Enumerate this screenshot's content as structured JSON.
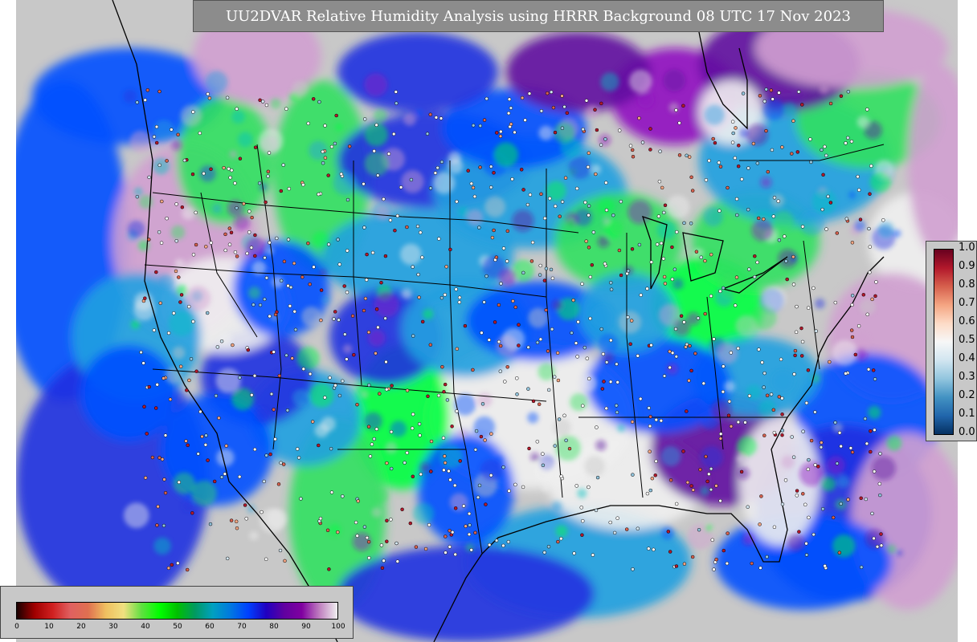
{
  "title": "UU2DVAR Relative Humidity Analysis using HRRR Background 08 UTC 17 Nov 2023",
  "colorbars": {
    "rh": {
      "ticks": [
        "0",
        "10",
        "20",
        "30",
        "40",
        "50",
        "60",
        "70",
        "80",
        "90",
        "100"
      ],
      "range": [
        0,
        100
      ],
      "stops": [
        "#1a0000",
        "#a00000",
        "#d02020",
        "#e06060",
        "#e07050",
        "#f0c060",
        "#f0e080",
        "#60e040",
        "#00ff00",
        "#00c000",
        "#009a60",
        "#00a0c0",
        "#0078e0",
        "#0040ff",
        "#2000c0",
        "#6000a0",
        "#8000a0",
        "#c080c0",
        "#f0f0f0"
      ]
    },
    "difference": {
      "ticks": [
        "0.0",
        "0.1",
        "0.2",
        "0.3",
        "0.4",
        "0.5",
        "0.6",
        "0.7",
        "0.8",
        "0.9",
        "1.0"
      ],
      "range": [
        0.0,
        1.0
      ],
      "stops": [
        "#053061",
        "#2166ac",
        "#4393c3",
        "#92c5de",
        "#d1e5f0",
        "#f7f7f7",
        "#fddbc7",
        "#f4a582",
        "#d6604d",
        "#b2182b",
        "#67001f"
      ]
    }
  },
  "map": {
    "background_gray": "#c8c8c8",
    "palette": [
      "#c8c8c8",
      "#2030e0",
      "#0050ff",
      "#20a0e0",
      "#00c0c0",
      "#30e060",
      "#00ff40",
      "#6010a0",
      "#9010c0",
      "#d0a0d0",
      "#f0f0f0"
    ]
  }
}
